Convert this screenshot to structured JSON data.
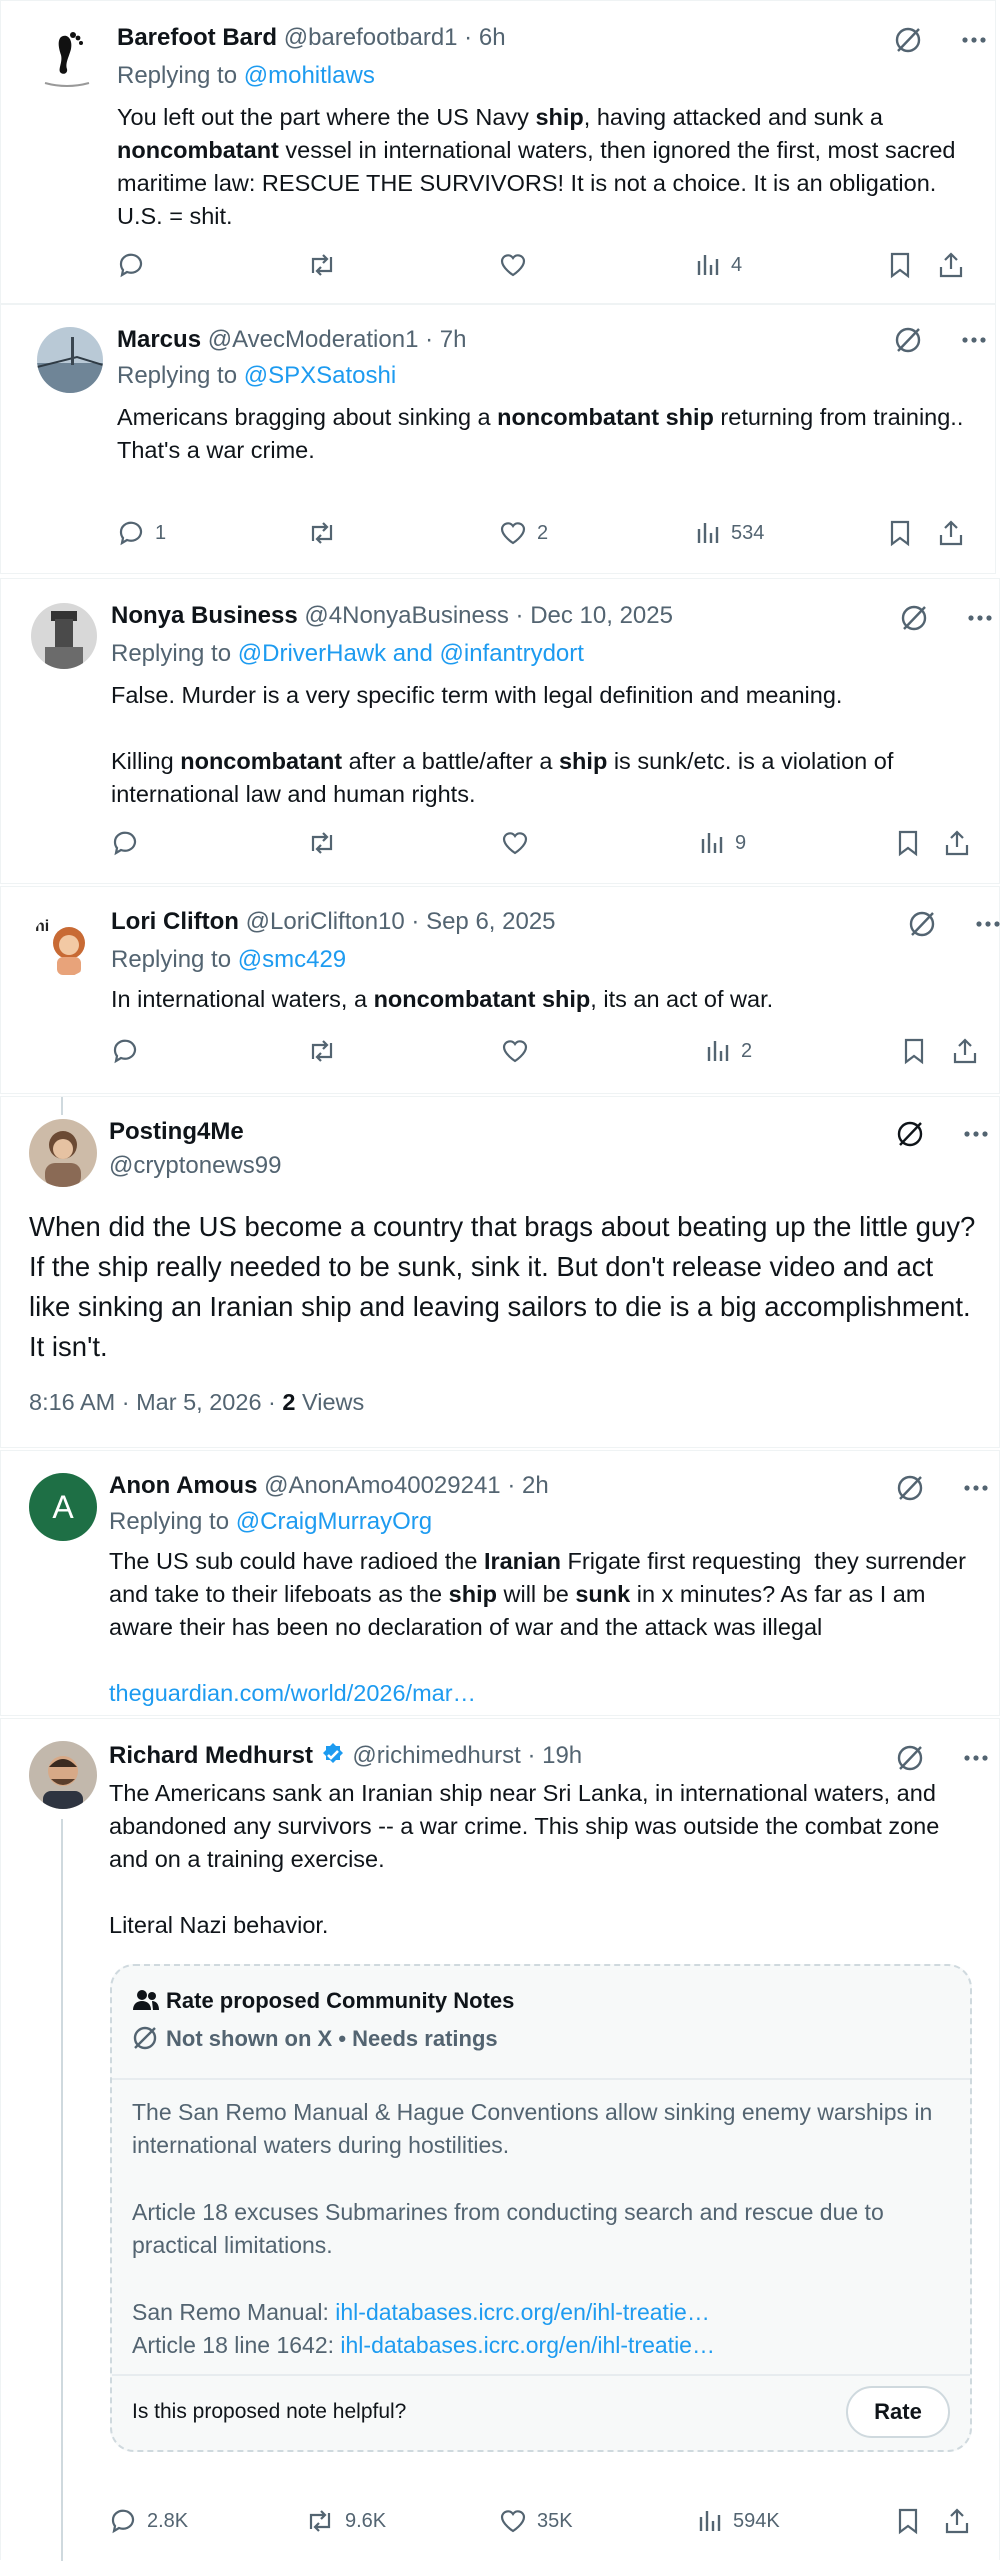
{
  "colors": {
    "accent": "#1d9bf0",
    "text": "#0f1419",
    "muted": "#536471",
    "verified": "#1d9bf0"
  },
  "tweets": [
    {
      "name": "Barefoot Bard",
      "meta": "@barefootbard1 · 6h",
      "reply_prefix": "Replying to ",
      "reply_to": "@mohitlaws",
      "body_html": "You left out the part where the US Navy <b>ship</b>, having attacked and sunk a <b>noncombatant</b> vessel in international waters, then ignored the first, most sacred maritime law: RESCUE THE SURVIVORS! It is not a choice. It is an obligation. U.S. = shit.",
      "replies": "",
      "reposts": "",
      "likes": "",
      "views": "4"
    },
    {
      "name": "Marcus",
      "meta": "@AvecModeration1 · 7h",
      "reply_prefix": "Replying to ",
      "reply_to": "@SPXSatoshi",
      "body_html": "Americans bragging about sinking a <b>noncombatant ship</b> returning from training..\nThat's a war crime.",
      "replies": "1",
      "reposts": "",
      "likes": "2",
      "views": "534"
    },
    {
      "name": "Nonya Business",
      "meta": "@4NonyaBusiness · Dec 10, 2025",
      "reply_prefix": "Replying to ",
      "reply_to": "@DriverHawk and @infantrydort",
      "body_html": "False. Murder is a very specific term with legal definition and meaning.\n\nKilling <b>noncombatant</b> after a battle/after a <b>ship</b> is sunk/etc. is a violation of international law and human rights.",
      "replies": "",
      "reposts": "",
      "likes": "",
      "views": "9"
    },
    {
      "name": "Lori Clifton",
      "meta": "@LoriClifton10 · Sep 6, 2025",
      "reply_prefix": "Replying to ",
      "reply_to": "@smc429",
      "body_html": "In international waters, a <b>noncombatant ship</b>, its an act of war.",
      "replies": "",
      "reposts": "",
      "likes": "",
      "views": "2"
    }
  ],
  "focus": {
    "name": "Posting4Me",
    "handle": "@cryptonews99",
    "body": "When did the US become a country that brags about beating up the little guy? If the ship really needed to be sunk, sink it. But don't release video and act like sinking an Iranian ship and leaving sailors to die is a big accomplishment. It isn't.",
    "time": "8:16 AM · Mar 5, 2026 · ",
    "views_count": "2",
    "views_label": " Views"
  },
  "anon": {
    "avatar_letter": "A",
    "name": "Anon Amous",
    "meta": "@AnonAmo40029241 · 2h",
    "reply_prefix": "Replying to ",
    "reply_to": "@CraigMurrayOrg",
    "body_html": "The US sub could have radioed the <b>Iranian</b> Frigate first requesting  they surrender and take to their lifeboats as the <b>ship</b> will be <b>sunk</b> in x minutes? As far as I am aware their has been no declaration of war and the attack was illegal",
    "link": "theguardian.com/world/2026/mar…"
  },
  "richard": {
    "name": "Richard Medhurst",
    "meta": "@richimedhurst · 19h",
    "body": "The Americans sank an Iranian ship near Sri Lanka, in international waters, and abandoned any survivors -- a war crime. This ship was outside the combat zone and on a training exercise.\n\nLiteral Nazi behavior.",
    "note": {
      "title": "Rate proposed Community Notes",
      "status": "Not shown on X • Needs ratings",
      "p1": "The San Remo Manual & Hague Conventions allow sinking enemy warships in international waters during hostilities.",
      "p2": "Article 18 excuses Submarines from conducting search and rescue due to practical limitations.",
      "src1_label": "San Remo Manual: ",
      "src1_link": "ihl-databases.icrc.org/en/ihl-treatie…",
      "src2_label": "Article 18 line 1642: ",
      "src2_link": "ihl-databases.icrc.org/en/ihl-treatie…",
      "question": "Is this proposed note helpful?",
      "rate_label": "Rate"
    },
    "replies": "2.8K",
    "reposts": "9.6K",
    "likes": "35K",
    "views": "594K"
  }
}
